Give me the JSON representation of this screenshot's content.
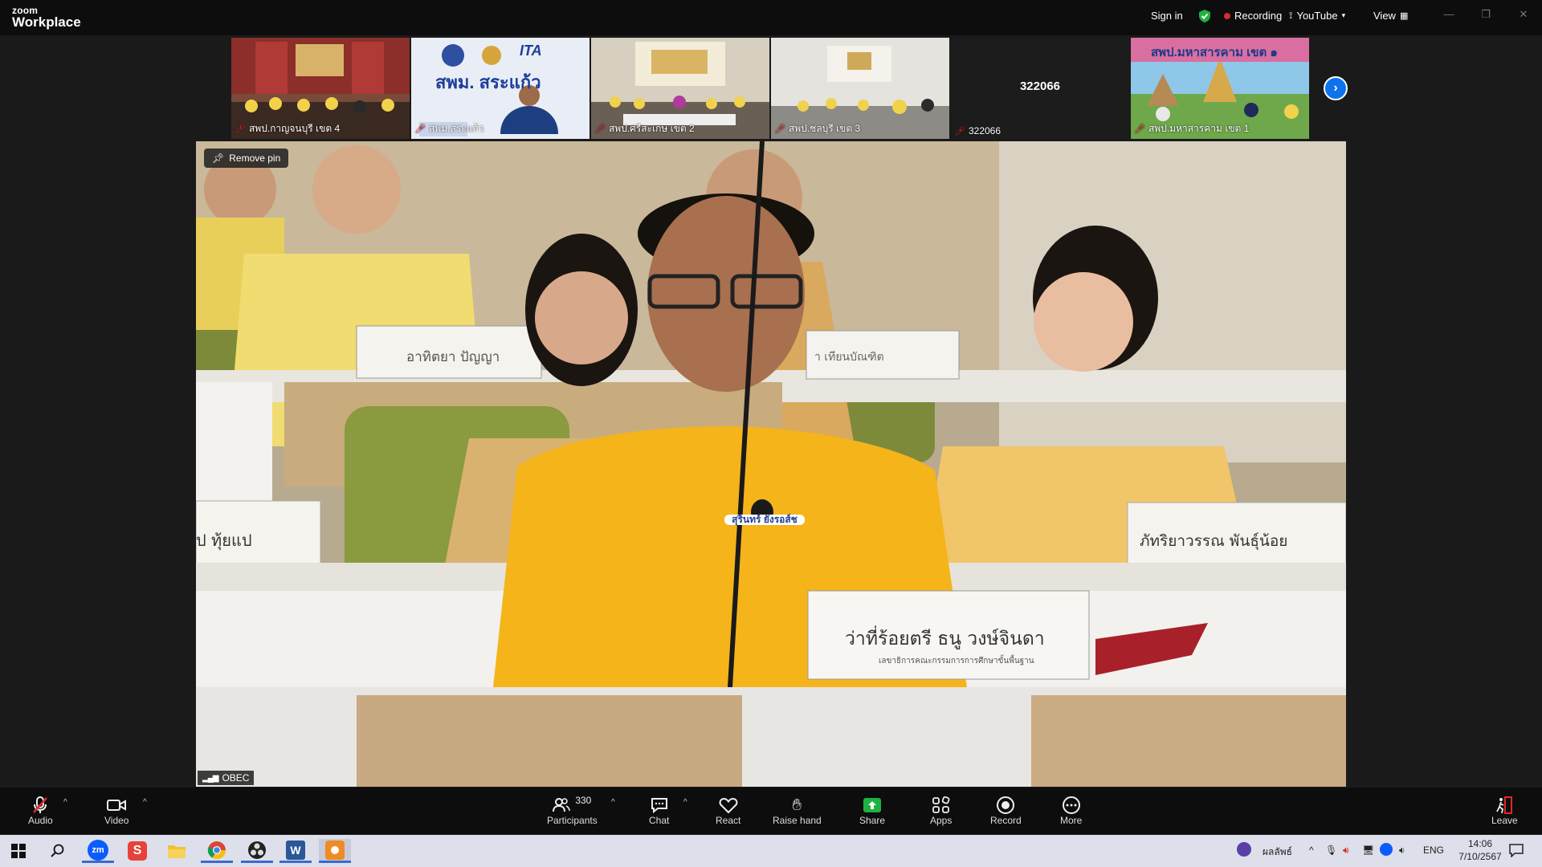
{
  "app": {
    "brand_top": "zoom",
    "brand_bottom": "Workplace"
  },
  "topbar": {
    "sign_in": "Sign in",
    "recording": "Recording",
    "stream": "YouTube",
    "view": "View",
    "shield_color": "#1fb141",
    "rec_color": "#e02828"
  },
  "thumbnails": [
    {
      "label": "สพป.กาญจนบุรี เขต 4",
      "muted": true
    },
    {
      "label": "สพม.สระแก้ว",
      "muted": true
    },
    {
      "label": "สพป.ศรีสะเกษ เขต 2",
      "muted": true
    },
    {
      "label": "สพป.ชลบุรี เขต 3",
      "muted": true
    },
    {
      "label": "322066",
      "center_text": "322066",
      "muted": true
    },
    {
      "label": "สพป.มหาสารคาม เขต 1",
      "muted": true
    }
  ],
  "thumb_texts": {
    "logo_text": "สพม. สระแก้ว",
    "logo_small": "ITA",
    "banner_text": "สพป.มหาสารคาม เขต ๑"
  },
  "main_video": {
    "remove_pin": "Remove pin",
    "participant_name": "OBEC",
    "nameplates": {
      "speaker": "ว่าที่ร้อยตรี ธนู วงษ์จินดา",
      "speaker_sub": "เลขาธิการคณะกรรมการการศึกษาขั้นพื้นฐาน",
      "right": "ภัทริยาวรรณ พันธุ์น้อย",
      "left_back": "อาทิตยา ปัญญา",
      "left_front": "ป ทุ้ยแป",
      "center_back": "า เทียนบัณฑิต",
      "badge": "สุรินทร์ ยังรอส์ช"
    }
  },
  "bottombar": {
    "audio": "Audio",
    "video": "Video",
    "participants": "Participants",
    "participants_count": "330",
    "chat": "Chat",
    "react": "React",
    "raise_hand": "Raise hand",
    "share": "Share",
    "apps": "Apps",
    "record": "Record",
    "more": "More",
    "leave": "Leave",
    "share_color": "#1fb141"
  },
  "taskbar": {
    "weather": "ผลลัพธ์",
    "lang": "ENG",
    "time": "14:06",
    "date": "7/10/2567"
  }
}
